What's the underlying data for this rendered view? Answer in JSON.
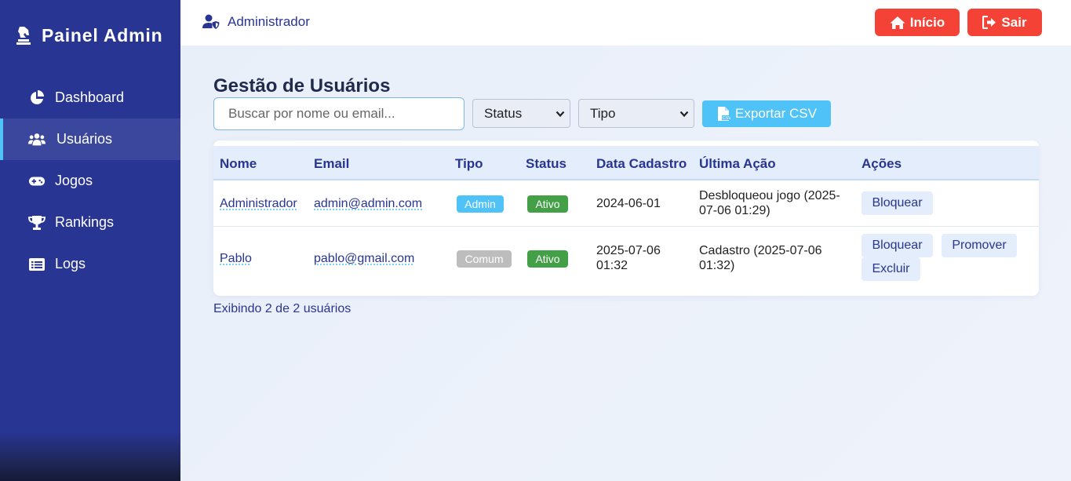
{
  "sidebar": {
    "brand": "Painel Admin",
    "items": [
      {
        "label": "Dashboard",
        "icon": "pie-chart-icon",
        "active": false
      },
      {
        "label": "Usuários",
        "icon": "users-icon",
        "active": true
      },
      {
        "label": "Jogos",
        "icon": "gamepad-icon",
        "active": false
      },
      {
        "label": "Rankings",
        "icon": "trophy-icon",
        "active": false
      },
      {
        "label": "Logs",
        "icon": "list-icon",
        "active": false
      }
    ]
  },
  "topbar": {
    "user_name": "Administrador",
    "home_label": "Início",
    "logout_label": "Sair"
  },
  "page": {
    "title": "Gestão de Usuários",
    "search_placeholder": "Buscar por nome ou email...",
    "status_select": "Status",
    "type_select": "Tipo",
    "export_label": "Exportar CSV",
    "footer": "Exibindo 2 de 2 usuários"
  },
  "table": {
    "headers": [
      "Nome",
      "Email",
      "Tipo",
      "Status",
      "Data Cadastro",
      "Última Ação",
      "Ações"
    ],
    "rows": [
      {
        "name": "Administrador",
        "email": "admin@admin.com",
        "type": "Admin",
        "status": "Ativo",
        "date_line1": "2024-06-01",
        "date_line2": "",
        "last_action_line1": "Desbloqueou jogo (2025-",
        "last_action_line2": "07-06 01:29)",
        "actions": [
          "Bloquear"
        ]
      },
      {
        "name": "Pablo",
        "email": "pablo@gmail.com",
        "type": "Comum",
        "status": "Ativo",
        "date_line1": "2025-07-06",
        "date_line2": "01:32",
        "last_action_line1": "Cadastro (2025-07-06",
        "last_action_line2": "01:32)",
        "actions": [
          "Bloquear",
          "Promover",
          "Excluir"
        ]
      }
    ]
  },
  "colors": {
    "sidebar": "#283593",
    "accent": "#4fc3f7",
    "danger": "#f44336",
    "badge_admin": "#4fc3f7",
    "badge_comum": "#bdbdbd",
    "badge_ativo": "#43a047"
  }
}
